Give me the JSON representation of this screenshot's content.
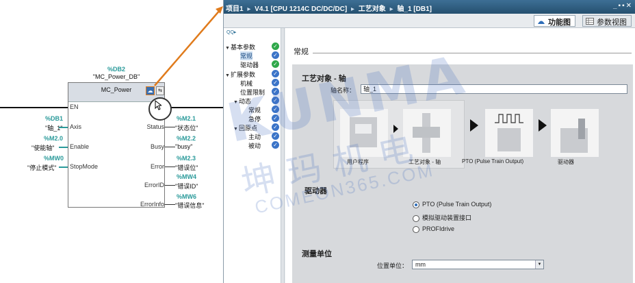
{
  "lad": {
    "db_addr": "%DB2",
    "db_name": "\"MC_Power_DB\"",
    "block_name": "MC_Power",
    "icon_a": "☁",
    "icon_b": "⇆",
    "pins_left": [
      "EN",
      "Axis",
      "Enable",
      "StopMode"
    ],
    "pins_right": [
      "Status",
      "Busy",
      "Error",
      "ErrorID",
      "ErrorInfo"
    ],
    "in_ops": [
      {
        "addr": "%DB1",
        "tag": "\"轴_1\""
      },
      {
        "addr": "%M2.0",
        "tag": "\"使能轴\""
      },
      {
        "addr": "%MW0",
        "tag": "\"停止模式\""
      }
    ],
    "out_ops": [
      {
        "addr": "%M2.1",
        "tag": "\"状态位\""
      },
      {
        "addr": "%M2.2",
        "tag": "\"busy\""
      },
      {
        "addr": "%M2.3",
        "tag": "\"错误位\""
      },
      {
        "addr": "%MW4",
        "tag": "\"错误ID\""
      },
      {
        "addr": "%MW6",
        "tag": "\"错误信息\""
      }
    ]
  },
  "window": {
    "breadcrumb": [
      "项目1",
      "V4.1 [CPU 1214C DC/DC/DC]",
      "工艺对象",
      "轴_1 [DB1]"
    ],
    "crumb_sep": "▸",
    "controls": "_▪▪✕",
    "tabs": [
      {
        "label": "功能图",
        "active": true
      },
      {
        "label": "参数视图",
        "active": false
      }
    ]
  },
  "nav": {
    "toolbar": "QQ▸",
    "items": [
      {
        "label": "基本参数",
        "expander": "▼",
        "status": "✓"
      },
      {
        "label": "常规",
        "expander": "",
        "status": "✓",
        "selected": true
      },
      {
        "label": "驱动器",
        "expander": "",
        "status": "✓"
      },
      {
        "label": "扩展参数",
        "expander": "▼",
        "status": "✓"
      },
      {
        "label": "机械",
        "expander": "",
        "status": "✓"
      },
      {
        "label": "位置限制",
        "expander": "",
        "status": "✓"
      },
      {
        "label": "动态",
        "expander": "▼",
        "status": "✓"
      },
      {
        "label": "常规",
        "expander": "",
        "status": "✓"
      },
      {
        "label": "急停",
        "expander": "",
        "status": "✓"
      },
      {
        "label": "回原点",
        "expander": "▼",
        "status": "✓"
      },
      {
        "label": "主动",
        "expander": "",
        "status": "✓"
      },
      {
        "label": "被动",
        "expander": "",
        "status": "✓"
      }
    ]
  },
  "content": {
    "section_title": "常规",
    "group1_title": "工艺对象 - 轴",
    "axis_name_label": "轴名称：",
    "axis_name_value": "轴_1",
    "flow_labels": [
      "用户程序",
      "工艺对象 - 轴",
      "PTO (Pulse Train Output)",
      "驱动器"
    ],
    "group2_title": "驱动器",
    "radios": [
      {
        "label": "PTO (Pulse Train Output)",
        "checked": true
      },
      {
        "label": "模拟驱动装置接口",
        "checked": false
      },
      {
        "label": "PROFIdrive",
        "checked": false
      }
    ],
    "group3_title": "测量单位",
    "unit_label": "位置单位：",
    "unit_value": "mm",
    "unit_arrow": "▼"
  },
  "watermark": {
    "brand": "KUNMA",
    "cn": "坤玛机电",
    "url": "COMEON365.COM"
  },
  "colors": {
    "title_bar": "#2f5f84",
    "operand_teal": "#2a9a9a",
    "check_blue": "#3b74c8",
    "check_green": "#2fa84a",
    "highlight_orange": "#e07b1c"
  }
}
